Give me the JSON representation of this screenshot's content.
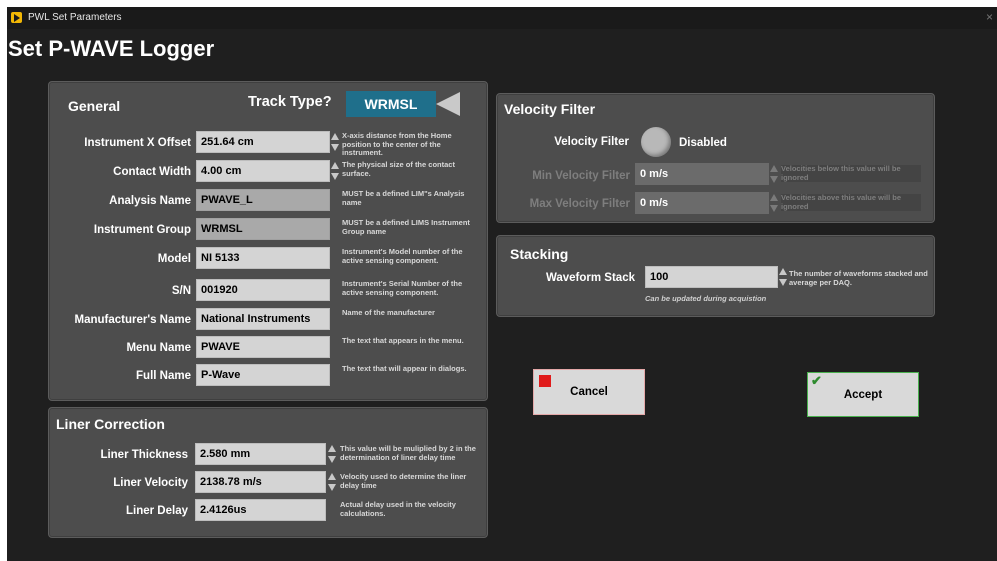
{
  "window": {
    "title": "PWL Set Parameters",
    "close_glyph": "×"
  },
  "page_title": "Set P-WAVE Logger",
  "general": {
    "title": "General",
    "track_type_label": "Track Type?",
    "track_type_value": "WRMSL",
    "rows": [
      {
        "label": "Instrument X Offset",
        "value": "251.64 cm",
        "desc": "X-axis distance from the Home position to the center of the instrument.",
        "readonly": false,
        "spinner": true
      },
      {
        "label": "Contact Width",
        "value": "4.00 cm",
        "desc": "The physical size of the contact surface.",
        "readonly": false,
        "spinner": true
      },
      {
        "label": "Analysis Name",
        "value": "PWAVE_L",
        "desc": "MUST be a defined LIM\"s Analysis name",
        "readonly": true,
        "spinner": false
      },
      {
        "label": "Instrument Group",
        "value": "WRMSL",
        "desc": "MUST be a defined LIMS Instrument Group name",
        "readonly": true,
        "spinner": false
      },
      {
        "label": "Model",
        "value": "NI 5133",
        "desc": "Instrument's Model number of the active sensing component.",
        "readonly": false,
        "spinner": false
      },
      {
        "label": "S/N",
        "value": "001920",
        "desc": "Instrument's Serial Number of the active sensing component.",
        "readonly": false,
        "spinner": false
      },
      {
        "label": "Manufacturer's Name",
        "value": "National Instruments",
        "desc": "Name of the manufacturer",
        "readonly": false,
        "spinner": false
      },
      {
        "label": "Menu Name",
        "value": "PWAVE",
        "desc": "The text that appears in the menu.",
        "readonly": false,
        "spinner": false
      },
      {
        "label": "Full Name",
        "value": "P-Wave",
        "desc": "The text that will appear in dialogs.",
        "readonly": false,
        "spinner": false
      }
    ]
  },
  "liner": {
    "title": "Liner Correction",
    "rows": [
      {
        "label": "Liner Thickness",
        "value": "2.580 mm",
        "desc": "This value will be muliplied by 2 in the determination of liner delay time",
        "spinner": true
      },
      {
        "label": "Liner Velocity",
        "value": "2138.78 m/s",
        "desc": "Velocity used to determine the liner delay time",
        "spinner": true
      },
      {
        "label": "Liner Delay",
        "value": "2.4126us",
        "desc": "Actual delay used in the velocity calculations.",
        "spinner": false
      }
    ]
  },
  "velocity": {
    "title": "Velocity Filter",
    "toggle_label": "Velocity Filter",
    "toggle_state": "Disabled",
    "min_label": "Min Velocity Filter",
    "min_value": "0 m/s",
    "min_desc": "Velocities below this value will be ignored",
    "max_label": "Max Velocity Filter",
    "max_value": "0 m/s",
    "max_desc": "Velocities above this value will be ignored"
  },
  "stacking": {
    "title": "Stacking",
    "label": "Waveform Stack",
    "value": "100",
    "desc": "The number of waveforms stacked and average per DAQ.",
    "note": "Can be updated during acquistion"
  },
  "buttons": {
    "cancel": "Cancel",
    "accept": "Accept"
  },
  "colors": {
    "track_type_bg": "#1f6f8b",
    "cancel_icon": "#e01b1b",
    "accept_border": "#49b04d"
  },
  "icons": {
    "cancel": "red-square-icon",
    "accept": "green-check-icon"
  }
}
